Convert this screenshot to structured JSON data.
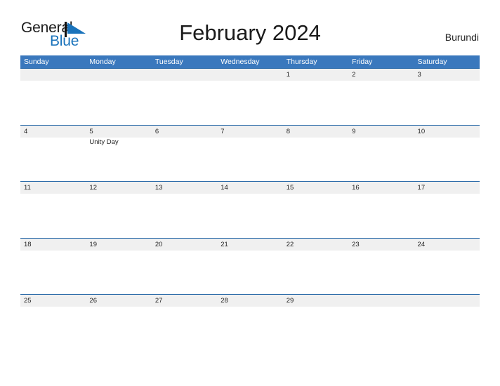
{
  "brand": {
    "line1": "General",
    "line2": "Blue",
    "flag_color": "#1a73bb",
    "text_color": "#1c1c1c"
  },
  "header": {
    "title": "February 2024",
    "country": "Burundi"
  },
  "theme": {
    "header_blue": "#3a78bd",
    "row_rule_blue": "#2a6aa8",
    "day_band_gray": "#f0f0f0",
    "page_background": "#ffffff"
  },
  "calendar": {
    "month": "February",
    "year": "2024",
    "weekday_headers": [
      "Sunday",
      "Monday",
      "Tuesday",
      "Wednesday",
      "Thursday",
      "Friday",
      "Saturday"
    ],
    "weeks": [
      {
        "days": [
          {
            "num": "",
            "events": []
          },
          {
            "num": "",
            "events": []
          },
          {
            "num": "",
            "events": []
          },
          {
            "num": "",
            "events": []
          },
          {
            "num": "1",
            "events": []
          },
          {
            "num": "2",
            "events": []
          },
          {
            "num": "3",
            "events": []
          }
        ]
      },
      {
        "days": [
          {
            "num": "4",
            "events": []
          },
          {
            "num": "5",
            "events": [
              "Unity Day"
            ]
          },
          {
            "num": "6",
            "events": []
          },
          {
            "num": "7",
            "events": []
          },
          {
            "num": "8",
            "events": []
          },
          {
            "num": "9",
            "events": []
          },
          {
            "num": "10",
            "events": []
          }
        ]
      },
      {
        "days": [
          {
            "num": "11",
            "events": []
          },
          {
            "num": "12",
            "events": []
          },
          {
            "num": "13",
            "events": []
          },
          {
            "num": "14",
            "events": []
          },
          {
            "num": "15",
            "events": []
          },
          {
            "num": "16",
            "events": []
          },
          {
            "num": "17",
            "events": []
          }
        ]
      },
      {
        "days": [
          {
            "num": "18",
            "events": []
          },
          {
            "num": "19",
            "events": []
          },
          {
            "num": "20",
            "events": []
          },
          {
            "num": "21",
            "events": []
          },
          {
            "num": "22",
            "events": []
          },
          {
            "num": "23",
            "events": []
          },
          {
            "num": "24",
            "events": []
          }
        ]
      },
      {
        "days": [
          {
            "num": "25",
            "events": []
          },
          {
            "num": "26",
            "events": []
          },
          {
            "num": "27",
            "events": []
          },
          {
            "num": "28",
            "events": []
          },
          {
            "num": "29",
            "events": []
          },
          {
            "num": "",
            "events": []
          },
          {
            "num": "",
            "events": []
          }
        ]
      }
    ]
  }
}
